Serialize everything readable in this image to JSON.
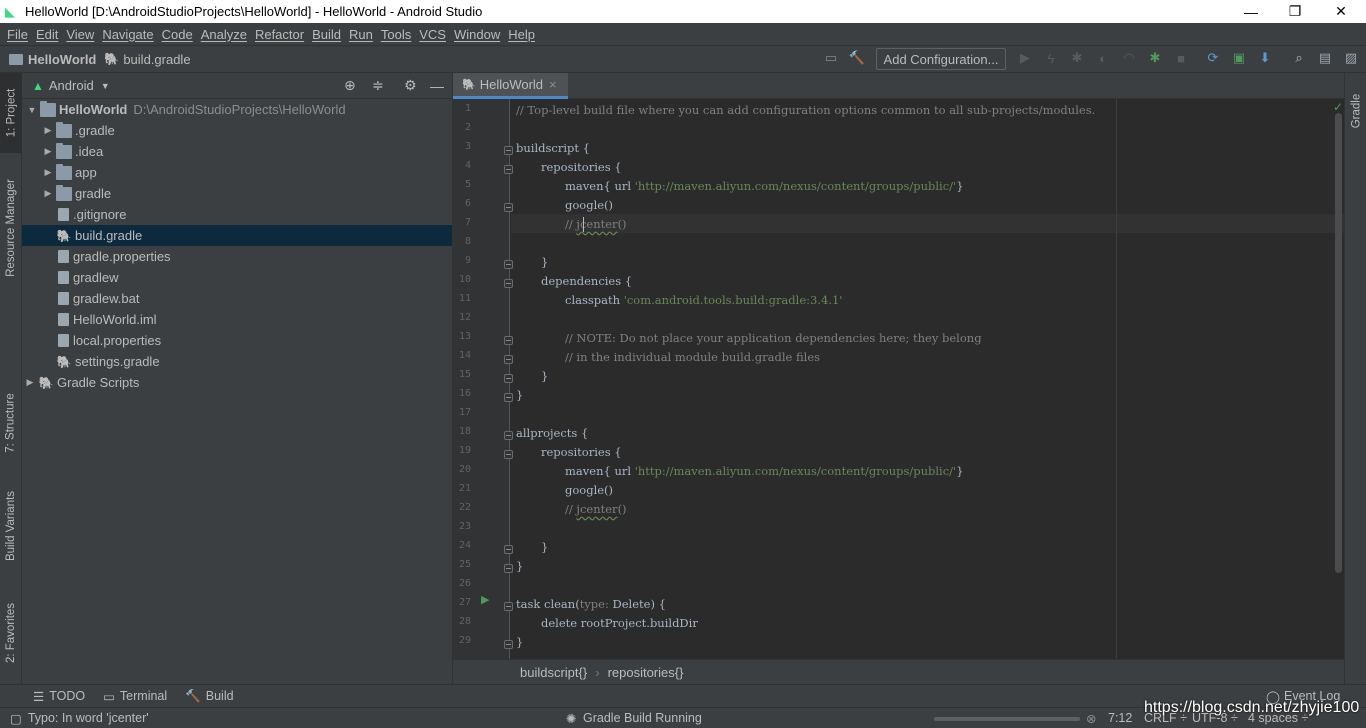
{
  "window": {
    "title": "HelloWorld [D:\\AndroidStudioProjects\\HelloWorld] - HelloWorld - Android Studio",
    "minimize": "—",
    "restore": "❐",
    "close": "✕"
  },
  "menu": [
    "File",
    "Edit",
    "View",
    "Navigate",
    "Code",
    "Analyze",
    "Refactor",
    "Build",
    "Run",
    "Tools",
    "VCS",
    "Window",
    "Help"
  ],
  "navbar": {
    "project": "HelloWorld",
    "file": "build.gradle",
    "add_configuration": "Add Configuration..."
  },
  "left_tool_tabs": [
    "1: Project",
    "Resource Manager",
    "7: Structure",
    "Build Variants",
    "2: Favorites"
  ],
  "right_tool_tabs": [
    "Gradle"
  ],
  "project_panel": {
    "view_mode": "Android",
    "root_name": "HelloWorld",
    "root_path": "D:\\AndroidStudioProjects\\HelloWorld",
    "items": [
      {
        "label": ".gradle",
        "kind": "folder",
        "expandable": true
      },
      {
        "label": ".idea",
        "kind": "folder",
        "expandable": true
      },
      {
        "label": "app",
        "kind": "folder",
        "expandable": true
      },
      {
        "label": "gradle",
        "kind": "folder",
        "expandable": true
      },
      {
        "label": ".gitignore",
        "kind": "file",
        "expandable": false
      },
      {
        "label": "build.gradle",
        "kind": "gradle",
        "expandable": false,
        "selected": true
      },
      {
        "label": "gradle.properties",
        "kind": "file",
        "expandable": false
      },
      {
        "label": "gradlew",
        "kind": "file",
        "expandable": false
      },
      {
        "label": "gradlew.bat",
        "kind": "file",
        "expandable": false
      },
      {
        "label": "HelloWorld.iml",
        "kind": "file",
        "expandable": false
      },
      {
        "label": "local.properties",
        "kind": "file",
        "expandable": false
      },
      {
        "label": "settings.gradle",
        "kind": "gradle",
        "expandable": false
      }
    ],
    "gradle_scripts": "Gradle Scripts"
  },
  "editor": {
    "tab_label": "HelloWorld",
    "tab_close": "×",
    "line_numbers": [
      "1",
      "2",
      "3",
      "4",
      "5",
      "6",
      "7",
      "8",
      "9",
      "10",
      "11",
      "12",
      "13",
      "14",
      "15",
      "16",
      "17",
      "18",
      "19",
      "20",
      "21",
      "22",
      "23",
      "24",
      "25",
      "26",
      "27",
      "28",
      "29"
    ],
    "lines": {
      "l1": "// Top-level build file where you can add configuration options common to all sub-projects/modules.",
      "l3": "buildscript {",
      "l4": "repositories {",
      "l5a": "maven{ url ",
      "l5b": "'http://maven.aliyun.com/nexus/content/groups/public/'",
      "l5c": "}",
      "l6": "google()",
      "l7a": "// ",
      "l7b": "jcenter",
      "l7c": "()",
      "l9": "}",
      "l10": "dependencies {",
      "l11a": "classpath ",
      "l11b": "'com.android.tools.build:gradle:3.4.1'",
      "l13": "// NOTE: Do not place your application dependencies here; they belong",
      "l14": "// in the individual module build.gradle files",
      "l15": "}",
      "l16": "}",
      "l18": "allprojects {",
      "l19": "repositories {",
      "l20a": "maven{ url ",
      "l20b": "'http://maven.aliyun.com/nexus/content/groups/public/'",
      "l20c": "}",
      "l21": "google()",
      "l22a": "// ",
      "l22b": "jcenter",
      "l22c": "()",
      "l24": "}",
      "l25": "}",
      "l27a": "task clean(",
      "l27b": "type: ",
      "l27c": "Delete) {",
      "l28": "delete rootProject.buildDir",
      "l29": "}"
    },
    "breadcrumb": [
      "buildscript{}",
      "repositories{}"
    ],
    "breadcrumb_sep": "›"
  },
  "bottom_tabs": [
    "TODO",
    "Terminal",
    "Build"
  ],
  "event_log": "Event Log",
  "status": {
    "message": "Typo: In word 'jcenter'",
    "task": "Gradle Build Running",
    "position": "7:12",
    "line_sep": "CRLF ÷",
    "encoding": "UTF-8 ÷",
    "indent": "4 spaces ÷"
  },
  "watermark": "https://blog.csdn.net/zhyjie100",
  "colors": {
    "accent": "#4a88c7",
    "background": "#2b2b2b",
    "panel": "#3c3f41",
    "selection": "#0d293e",
    "string": "#6a8759",
    "comment": "#808080"
  }
}
